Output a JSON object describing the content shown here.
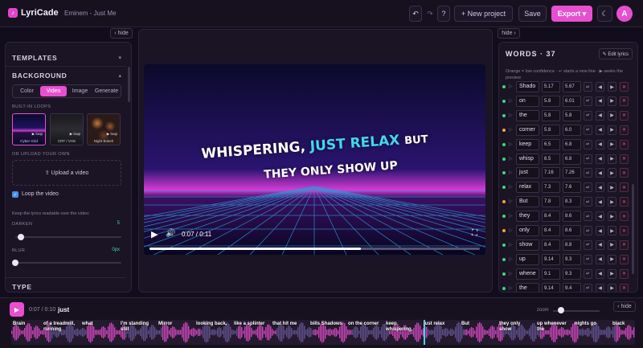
{
  "app": {
    "name": "LyriCade",
    "song": "Eminem - Just Me",
    "new_project": "+ New project",
    "save": "Save",
    "export": "Export ▾",
    "avatar": "A",
    "undo_glyph": "↶",
    "redo_glyph": "↷",
    "help_glyph": "?",
    "theme_glyph": "☾"
  },
  "hide_label": "‹ hide",
  "hide_label_r": "hide ›",
  "hide_label_b": "‹ hide",
  "left": {
    "templates": "TEMPLATES",
    "background": "BACKGROUND",
    "tabs": [
      "Color",
      "Video",
      "Image",
      "Generate"
    ],
    "active_tab": "Video",
    "builtin": "BUILT-IN LOOPS",
    "loops": [
      {
        "name": "Cyber Grid",
        "tag": "▶ loop"
      },
      {
        "name": "CRT / VHS",
        "tag": "▶ loop"
      },
      {
        "name": "Night Bokeh",
        "tag": "▶ loop"
      }
    ],
    "upload_or": "OR UPLOAD YOUR OWN",
    "upload": "⇧ Upload a video",
    "loop_check": "Loop the video",
    "readable_hint": "Keep the lyrics readable over the video:",
    "darken": "DARKEN",
    "darken_val": "5",
    "darken_level": 0.05,
    "blur": "BLUR",
    "blur_val": "0px",
    "blur_level": 0,
    "type": "TYPE"
  },
  "video": {
    "line1_a": "WHISPERING,",
    "line1_b": "JUST",
    "line1_c": "RELAX",
    "line1_d": "BUT",
    "line2": "THEY ONLY SHOW UP",
    "time": "0:07 / 0:11",
    "progress": 0.64
  },
  "words": {
    "title": "WORDS · 37",
    "edit": "✎ Edit lyrics",
    "help": "Orange = low confidence · ↵ starts a new line · ▶ seeks the preview",
    "rows": [
      {
        "w": "Shado",
        "s": "5.17",
        "e": "5.67",
        "c": "#3fd67a"
      },
      {
        "w": "on",
        "s": "5.8",
        "e": "6.01",
        "c": "#3fd67a"
      },
      {
        "w": "the",
        "s": "5.8",
        "e": "5.8",
        "c": "#3fd67a"
      },
      {
        "w": "corner",
        "s": "5.8",
        "e": "6.0",
        "c": "#f0a53a"
      },
      {
        "w": "keep",
        "s": "6.5",
        "e": "6.8",
        "c": "#3fd67a"
      },
      {
        "w": "whisp",
        "s": "6.5",
        "e": "6.8",
        "c": "#3fd67a"
      },
      {
        "w": "just",
        "s": "7.16",
        "e": "7.26",
        "c": "#3fd67a"
      },
      {
        "w": "relax",
        "s": "7.3",
        "e": "7.6",
        "c": "#3fd67a"
      },
      {
        "w": "But",
        "s": "7.8",
        "e": "8.3",
        "c": "#f0a53a"
      },
      {
        "w": "they",
        "s": "8.4",
        "e": "8.6",
        "c": "#3fd67a"
      },
      {
        "w": "only",
        "s": "8.4",
        "e": "8.6",
        "c": "#f0a53a"
      },
      {
        "w": "show",
        "s": "8.4",
        "e": "8.8",
        "c": "#3fd67a"
      },
      {
        "w": "up",
        "s": "9.14",
        "e": "9.3",
        "c": "#3fd67a"
      },
      {
        "w": "whene",
        "s": "9.1",
        "e": "9.3",
        "c": "#3fd67a"
      },
      {
        "w": "the",
        "s": "9.14",
        "e": "9.4",
        "c": "#3fd67a"
      }
    ]
  },
  "bottom": {
    "play": "▶",
    "time": "0:07 / 0:10",
    "current": "just",
    "zoom": "zoom"
  },
  "timeline": [
    {
      "t": "Brain"
    },
    {
      "t": "of a treadmill, running"
    },
    {
      "t": "what"
    },
    {
      "t": "I'm standing still"
    },
    {
      "t": "Mirror"
    },
    {
      "t": "looking back,"
    },
    {
      "t": "like a splinter"
    },
    {
      "t": "that hit me"
    },
    {
      "t": "bills Shadows"
    },
    {
      "t": "on the corner"
    },
    {
      "t": "keep whispering,"
    },
    {
      "t": "just relax"
    },
    {
      "t": "But"
    },
    {
      "t": "they only show"
    },
    {
      "t": "up whenever the"
    },
    {
      "t": "nights go"
    },
    {
      "t": "black"
    }
  ]
}
